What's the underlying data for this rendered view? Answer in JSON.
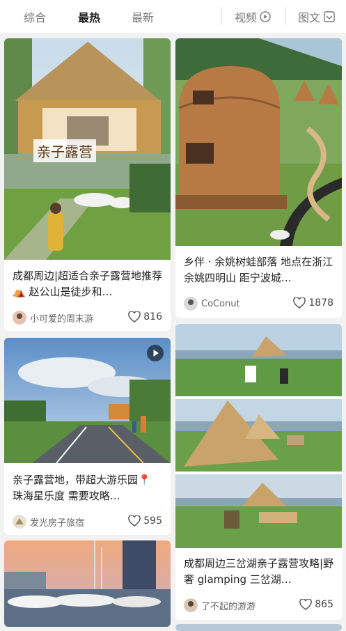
{
  "tabs": [
    {
      "label": "综合"
    },
    {
      "label": "最热"
    },
    {
      "label": "最新"
    },
    {
      "label": "视频"
    },
    {
      "label": "图文"
    }
  ],
  "cards": [
    {
      "title": "成都周边|超适合亲子露营地推荐⛺ 赵公山是徒步和…",
      "author": "小可爱的周末游",
      "likes": "816",
      "overlay": "亲子露营"
    },
    {
      "title": "乡伴 · 余姚树蛙部落 地点在浙江余姚四明山 距宁波城…",
      "author": "CoConut",
      "likes": "1878"
    },
    {
      "title": "亲子露营地，带超大游乐园📍 珠海星乐度 需要攻略…",
      "author": "发光房子旅宿",
      "likes": "595"
    },
    {
      "title": "成都周边三岔湖亲子露营攻略|野奢 glamping 三岔湖…",
      "author": "了不起的游游",
      "likes": "865"
    }
  ],
  "colors": {
    "accent": "#222222",
    "background": "#f2f2f2",
    "card": "#ffffff"
  },
  "icons": [
    "play-circle-icon",
    "filter-icon",
    "heart-icon",
    "video-play-icon"
  ]
}
